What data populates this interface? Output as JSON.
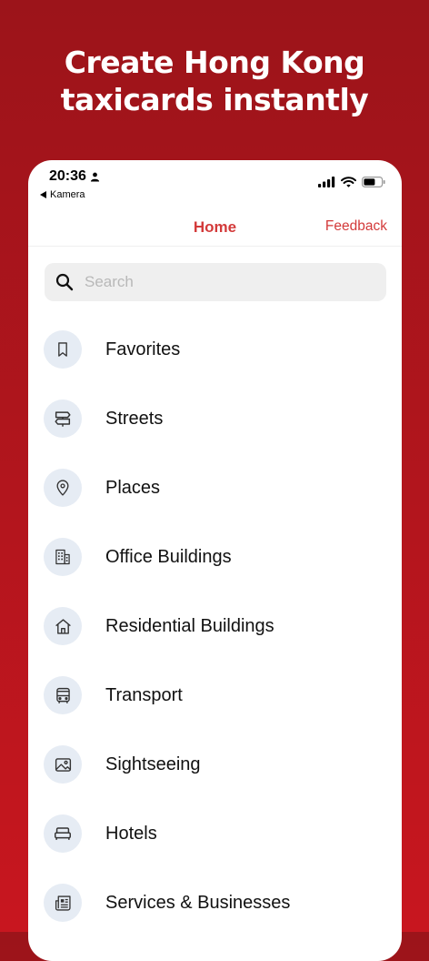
{
  "headline": {
    "line1": "Create Hong Kong",
    "line2": "taxicards instantly"
  },
  "status_bar": {
    "time": "20:36",
    "back_label": "Kamera"
  },
  "nav": {
    "title": "Home",
    "feedback": "Feedback"
  },
  "search": {
    "placeholder": "Search"
  },
  "colors": {
    "accent": "#d33a3a",
    "icon_bg": "#e6ecf4",
    "background": "#b3151d"
  },
  "categories": [
    {
      "label": "Favorites",
      "icon": "bookmark-icon"
    },
    {
      "label": "Streets",
      "icon": "signpost-icon"
    },
    {
      "label": "Places",
      "icon": "map-pin-icon"
    },
    {
      "label": "Office Buildings",
      "icon": "office-building-icon"
    },
    {
      "label": "Residential Buildings",
      "icon": "home-icon"
    },
    {
      "label": "Transport",
      "icon": "bus-icon"
    },
    {
      "label": "Sightseeing",
      "icon": "image-icon"
    },
    {
      "label": "Hotels",
      "icon": "bed-icon"
    },
    {
      "label": "Services & Businesses",
      "icon": "newspaper-icon"
    }
  ]
}
